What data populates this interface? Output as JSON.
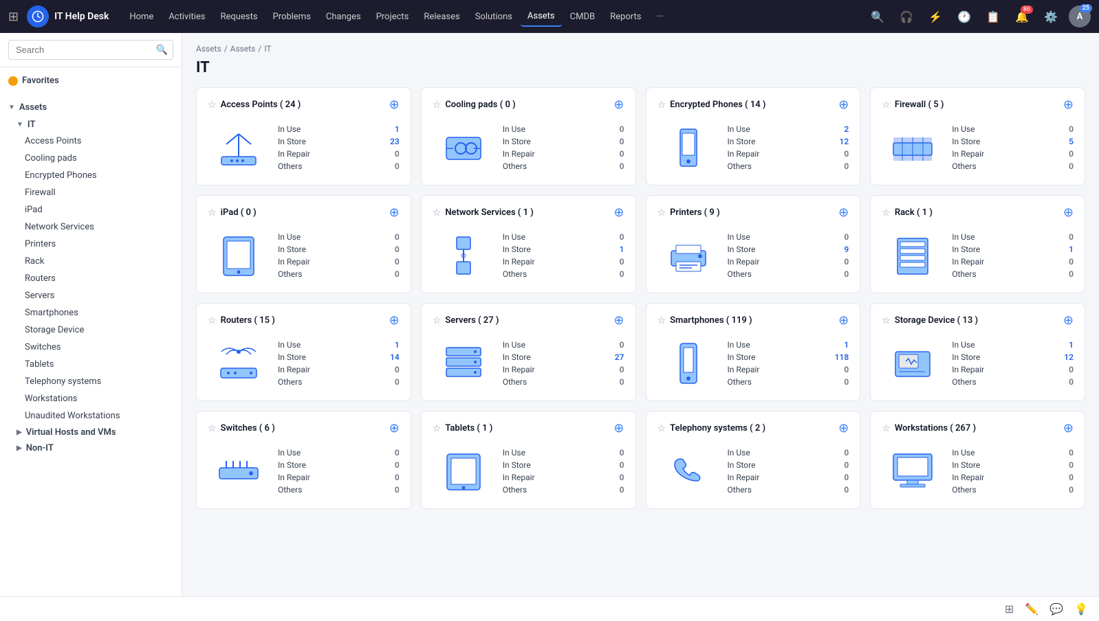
{
  "app": {
    "name": "IT Help Desk",
    "nav": [
      "Home",
      "Activities",
      "Requests",
      "Problems",
      "Changes",
      "Projects",
      "Releases",
      "Solutions",
      "Assets",
      "CMDB",
      "Reports",
      "..."
    ],
    "active_nav": "Assets",
    "badges": {
      "notifications": "86",
      "user": "25"
    }
  },
  "sidebar": {
    "search_placeholder": "Search",
    "favorites_label": "Favorites",
    "assets_label": "Assets",
    "it_label": "IT",
    "items": [
      "Access Points",
      "Cooling pads",
      "Encrypted Phones",
      "Firewall",
      "iPad",
      "Network Services",
      "Printers",
      "Rack",
      "Routers",
      "Servers",
      "Smartphones",
      "Storage Device",
      "Switches",
      "Tablets",
      "Telephony systems",
      "Workstations",
      "Unaudited Workstations"
    ],
    "virtual_hosts_label": "Virtual Hosts and VMs",
    "non_it_label": "Non-IT"
  },
  "breadcrumb": [
    "Assets",
    "Assets",
    "IT"
  ],
  "page_title": "IT",
  "cards": [
    {
      "title": "Access Points",
      "count": "24",
      "in_use": "1",
      "in_use_colored": true,
      "in_store": "23",
      "in_store_colored": true,
      "in_repair": "0",
      "in_repair_colored": false,
      "others": "0",
      "others_colored": false,
      "icon": "access_point"
    },
    {
      "title": "Cooling pads",
      "count": "0",
      "in_use": "0",
      "in_use_colored": false,
      "in_store": "0",
      "in_store_colored": false,
      "in_repair": "0",
      "in_repair_colored": false,
      "others": "0",
      "others_colored": false,
      "icon": "cooling"
    },
    {
      "title": "Encrypted Phones",
      "count": "14",
      "in_use": "2",
      "in_use_colored": true,
      "in_store": "12",
      "in_store_colored": true,
      "in_repair": "0",
      "in_repair_colored": false,
      "others": "0",
      "others_colored": false,
      "icon": "phone"
    },
    {
      "title": "Firewall",
      "count": "5",
      "in_use": "0",
      "in_use_colored": false,
      "in_store": "5",
      "in_store_colored": true,
      "in_repair": "0",
      "in_repair_colored": false,
      "others": "0",
      "others_colored": false,
      "icon": "firewall"
    },
    {
      "title": "iPad",
      "count": "0",
      "in_use": "0",
      "in_use_colored": false,
      "in_store": "0",
      "in_store_colored": false,
      "in_repair": "0",
      "in_repair_colored": false,
      "others": "0",
      "others_colored": false,
      "icon": "ipad"
    },
    {
      "title": "Network Services",
      "count": "1",
      "in_use": "0",
      "in_use_colored": false,
      "in_store": "1",
      "in_store_colored": true,
      "in_repair": "0",
      "in_repair_colored": false,
      "others": "0",
      "others_colored": false,
      "icon": "network"
    },
    {
      "title": "Printers",
      "count": "9",
      "in_use": "0",
      "in_use_colored": false,
      "in_store": "9",
      "in_store_colored": true,
      "in_repair": "0",
      "in_repair_colored": false,
      "others": "0",
      "others_colored": false,
      "icon": "printer"
    },
    {
      "title": "Rack",
      "count": "1",
      "in_use": "0",
      "in_use_colored": false,
      "in_store": "1",
      "in_store_colored": true,
      "in_repair": "0",
      "in_repair_colored": false,
      "others": "0",
      "others_colored": false,
      "icon": "rack"
    },
    {
      "title": "Routers",
      "count": "15",
      "in_use": "1",
      "in_use_colored": true,
      "in_store": "14",
      "in_store_colored": true,
      "in_repair": "0",
      "in_repair_colored": false,
      "others": "0",
      "others_colored": false,
      "icon": "router"
    },
    {
      "title": "Servers",
      "count": "27",
      "in_use": "0",
      "in_use_colored": false,
      "in_store": "27",
      "in_store_colored": true,
      "in_repair": "0",
      "in_repair_colored": false,
      "others": "0",
      "others_colored": false,
      "icon": "server"
    },
    {
      "title": "Smartphones",
      "count": "119",
      "in_use": "1",
      "in_use_colored": true,
      "in_store": "118",
      "in_store_colored": true,
      "in_repair": "0",
      "in_repair_colored": false,
      "others": "0",
      "others_colored": false,
      "icon": "smartphone"
    },
    {
      "title": "Storage Device",
      "count": "13",
      "in_use": "1",
      "in_use_colored": true,
      "in_store": "12",
      "in_store_colored": true,
      "in_repair": "0",
      "in_repair_colored": false,
      "others": "0",
      "others_colored": false,
      "icon": "storage"
    },
    {
      "title": "Switches",
      "count": "6",
      "in_use": "0",
      "in_use_colored": false,
      "in_store": "0",
      "in_store_colored": false,
      "in_repair": "0",
      "in_repair_colored": false,
      "others": "0",
      "others_colored": false,
      "icon": "switch"
    },
    {
      "title": "Tablets",
      "count": "1",
      "in_use": "0",
      "in_use_colored": false,
      "in_store": "0",
      "in_store_colored": false,
      "in_repair": "0",
      "in_repair_colored": false,
      "others": "0",
      "others_colored": false,
      "icon": "tablet"
    },
    {
      "title": "Telephony systems",
      "count": "2",
      "in_use": "0",
      "in_use_colored": false,
      "in_store": "0",
      "in_store_colored": false,
      "in_repair": "0",
      "in_repair_colored": false,
      "others": "0",
      "others_colored": false,
      "icon": "telephony"
    },
    {
      "title": "Workstations",
      "count": "267",
      "in_use": "0",
      "in_use_colored": false,
      "in_store": "0",
      "in_store_colored": false,
      "in_repair": "0",
      "in_repair_colored": false,
      "others": "0",
      "others_colored": false,
      "icon": "workstation"
    }
  ],
  "labels": {
    "in_use": "In Use",
    "in_store": "In Store",
    "in_repair": "In Repair",
    "others": "Others"
  }
}
